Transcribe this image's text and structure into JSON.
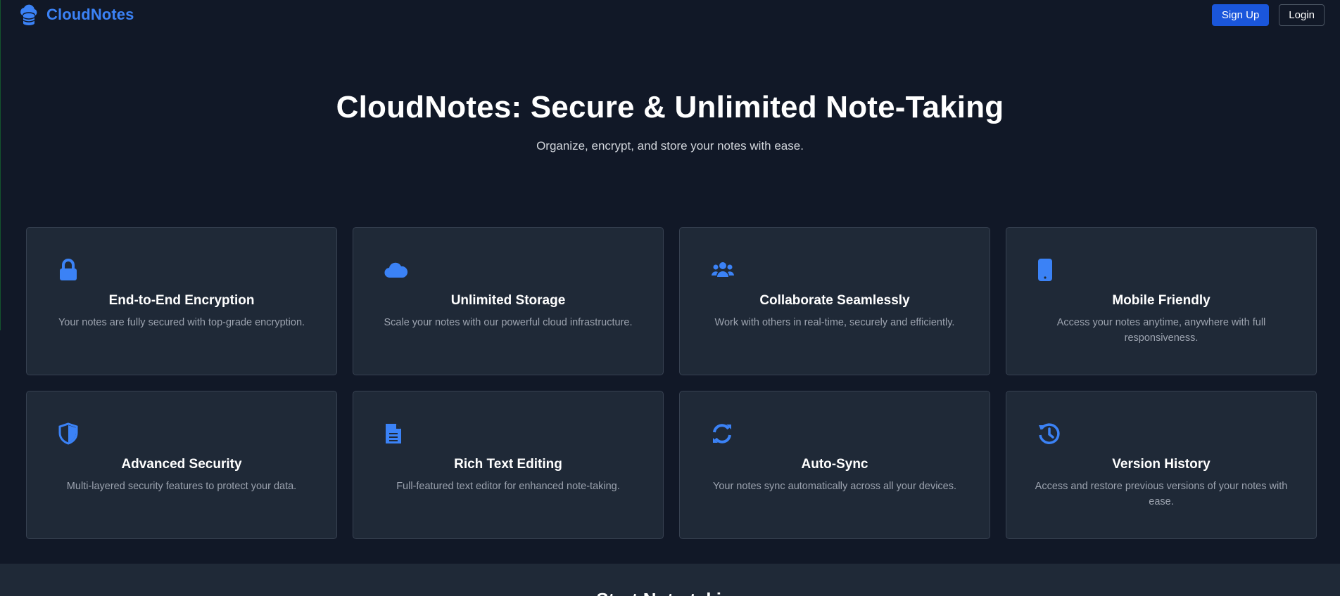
{
  "brand": {
    "name": "CloudNotes",
    "logo_icon": "cloud-database-icon",
    "accent_color": "#3b82f6"
  },
  "nav": {
    "signup_label": "Sign Up",
    "login_label": "Login"
  },
  "hero": {
    "title": "CloudNotes: Secure & Unlimited Note-Taking",
    "subtitle": "Organize, encrypt, and store your notes with ease."
  },
  "features": [
    {
      "icon": "lock-icon",
      "title": "End-to-End Encryption",
      "description": "Your notes are fully secured with top-grade encryption."
    },
    {
      "icon": "cloud-icon",
      "title": "Unlimited Storage",
      "description": "Scale your notes with our powerful cloud infrastructure."
    },
    {
      "icon": "users-icon",
      "title": "Collaborate Seamlessly",
      "description": "Work with others in real-time, securely and efficiently."
    },
    {
      "icon": "mobile-icon",
      "title": "Mobile Friendly",
      "description": "Access your notes anytime, anywhere with full responsiveness."
    },
    {
      "icon": "shield-icon",
      "title": "Advanced Security",
      "description": "Multi-layered security features to protect your data."
    },
    {
      "icon": "document-icon",
      "title": "Rich Text Editing",
      "description": "Full-featured text editor for enhanced note-taking."
    },
    {
      "icon": "sync-icon",
      "title": "Auto-Sync",
      "description": "Your notes sync automatically across all your devices."
    },
    {
      "icon": "history-icon",
      "title": "Version History",
      "description": "Access and restore previous versions of your notes with ease."
    }
  ],
  "next_section": {
    "title": "Start Note-taking"
  },
  "colors": {
    "background": "#111827",
    "card": "#1f2937",
    "card_border": "#374151",
    "primary_button": "#1a56db",
    "icon": "#3b82f6"
  }
}
